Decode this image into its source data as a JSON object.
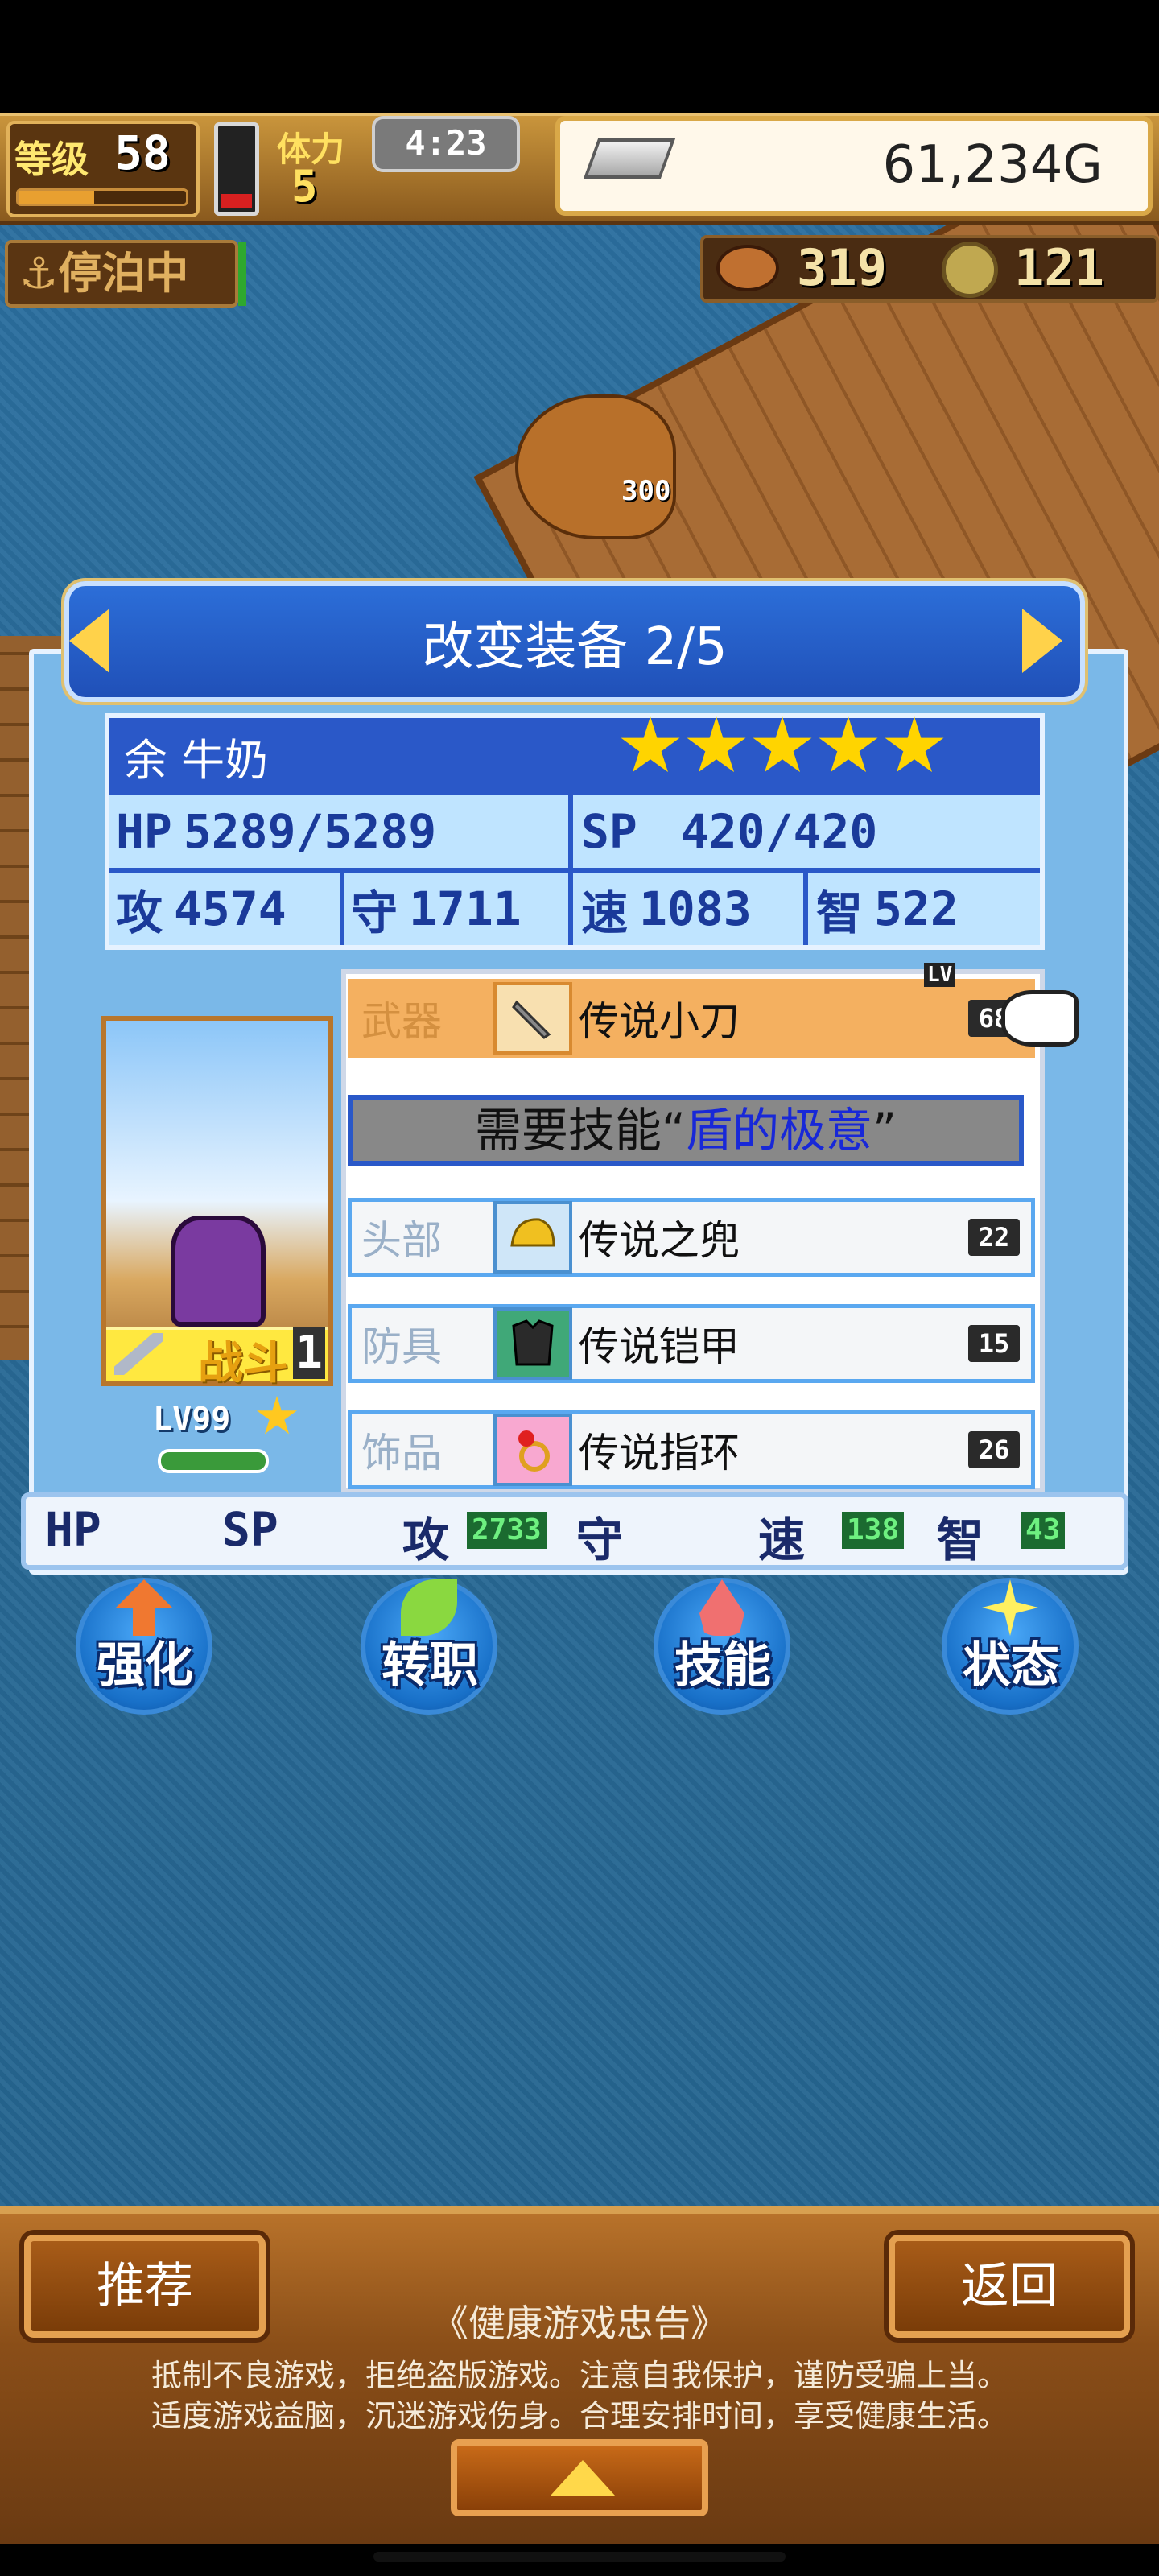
{
  "topbar": {
    "level_label": "等级",
    "level": "58",
    "stamina_label": "体力",
    "stamina": "5",
    "clock": "4:23",
    "gold": "61,234G"
  },
  "status_bar": {
    "dock_label": "停泊中",
    "resource1": "319",
    "resource2": "121"
  },
  "scene": {
    "damage_number": "300"
  },
  "panel": {
    "title": "改变装备 2/5",
    "character": {
      "name": "余 牛奶",
      "stars": 5,
      "hp_label": "HP",
      "hp": "5289/5289",
      "sp_label": "SP",
      "sp": "420/420",
      "atk_label": "攻",
      "atk": "4574",
      "def_label": "守",
      "def": "1711",
      "spd_label": "速",
      "spd": "1083",
      "int_label": "智",
      "int": "522",
      "portrait_tag": "战斗",
      "portrait_num": "1",
      "level": "LV99"
    },
    "equipment": [
      {
        "slot": "武器",
        "name": "传说小刀",
        "level": "68",
        "icon": "dagger-icon",
        "selected": true
      },
      {
        "slot": "头部",
        "name": "传说之兜",
        "level": "22",
        "icon": "helmet-icon",
        "selected": false
      },
      {
        "slot": "防具",
        "name": "传说铠甲",
        "level": "15",
        "icon": "armor-icon",
        "selected": false
      },
      {
        "slot": "饰品",
        "name": "传说指环",
        "level": "26",
        "icon": "ring-icon",
        "selected": false
      }
    ],
    "lv_tag": "LV",
    "requirement": {
      "prefix": "需要技能“",
      "skill": "盾的极意",
      "suffix": "”"
    },
    "summary": {
      "hp_label": "HP",
      "sp_label": "SP",
      "atk_label": "攻",
      "atk": "2733",
      "def_label": "守",
      "spd_label": "速",
      "spd": "138",
      "int_label": "智",
      "int": "43"
    }
  },
  "actions": [
    {
      "label": "强化",
      "icon": "arrow-up-icon",
      "color": "#f07830"
    },
    {
      "label": "转职",
      "icon": "leaf-icon",
      "color": "#8ad840"
    },
    {
      "label": "技能",
      "icon": "flame-icon",
      "color": "#f07070"
    },
    {
      "label": "状态",
      "icon": "sparkle-icon",
      "color": "#fff060"
    }
  ],
  "footer": {
    "recommend": "推荐",
    "back": "返回",
    "notice_title": "《健康游戏忠告》",
    "notice_line1": "抵制不良游戏，拒绝盗版游戏。注意自我保护，谨防受骗上当。",
    "notice_line2": "适度游戏益脑，沉迷游戏伤身。合理安排时间，享受健康生活。"
  }
}
